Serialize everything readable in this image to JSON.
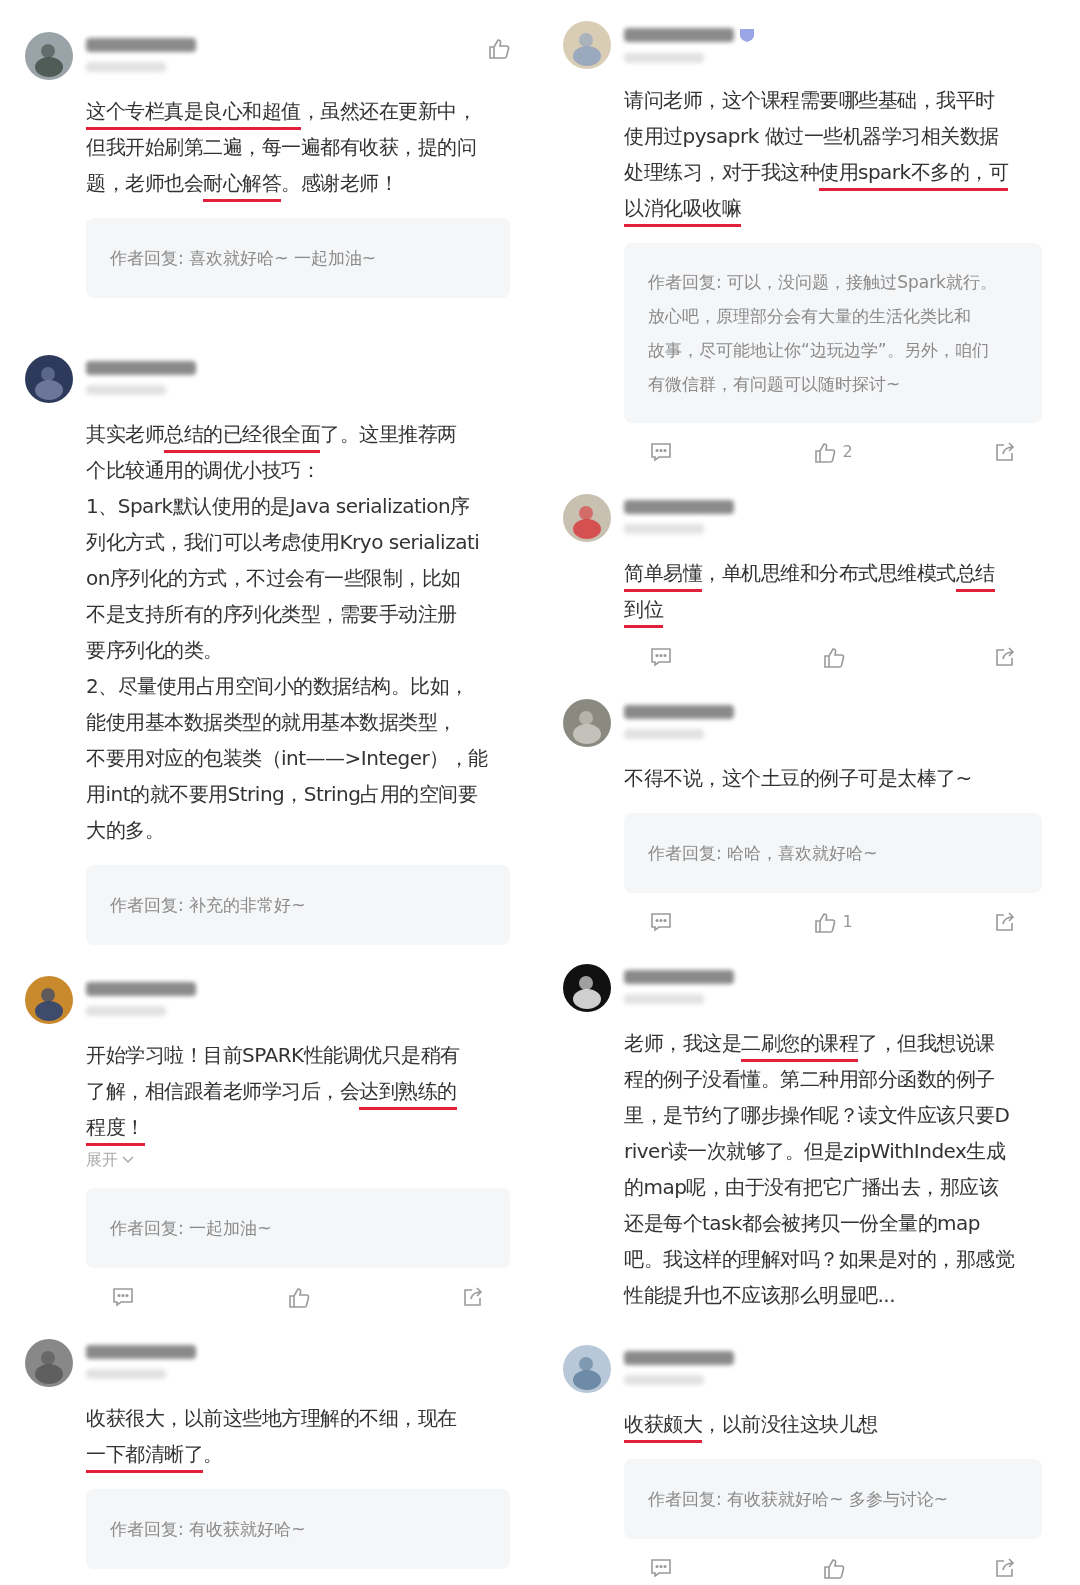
{
  "columns": [
    {
      "comments": [
        {
          "header_like": true,
          "badge": false,
          "lines": [
            [
              {
                "text": "这个专栏真是良心和超值",
                "underlined": true
              },
              {
                "text": "，虽然还在更新中，",
                "underlined": false
              }
            ],
            [
              {
                "text": "但我开始刷第二遍，每一遍都有收获，提的问",
                "underlined": false
              }
            ],
            [
              {
                "text": "题，老师也会",
                "underlined": false
              },
              {
                "text": "耐心解答",
                "underlined": true
              },
              {
                "text": "。感谢老师！",
                "underlined": false
              }
            ]
          ],
          "reply": [
            "作者回复: 喜欢就好哈~ 一起加油~"
          ]
        },
        {
          "header_like": false,
          "badge": false,
          "lines": [
            [
              {
                "text": "其实老师",
                "underlined": false
              },
              {
                "text": "总结的已经很全面",
                "underlined": true
              },
              {
                "text": "了。这里推荐两",
                "underlined": false
              }
            ],
            [
              {
                "text": "个比较通用的调优小技巧：",
                "underlined": false
              }
            ],
            [
              {
                "text": "1、Spark默认使用的是Java serialization序",
                "underlined": false
              }
            ],
            [
              {
                "text": "列化方式，我们可以考虑使用Kryo serializati",
                "underlined": false
              }
            ],
            [
              {
                "text": "on序列化的方式，不过会有一些限制，比如",
                "underlined": false
              }
            ],
            [
              {
                "text": "不是支持所有的序列化类型，需要手动注册",
                "underlined": false
              }
            ],
            [
              {
                "text": "要序列化的类。",
                "underlined": false
              }
            ],
            [
              {
                "text": "2、尽量使用占用空间小的数据结构。比如，",
                "underlined": false
              }
            ],
            [
              {
                "text": "能使用基本数据类型的就用基本数据类型，",
                "underlined": false
              }
            ],
            [
              {
                "text": "不要用对应的包装类（int——>Integer），能",
                "underlined": false
              }
            ],
            [
              {
                "text": "用int的就不要用String，String占用的空间要",
                "underlined": false
              }
            ],
            [
              {
                "text": "大的多。",
                "underlined": false
              }
            ]
          ],
          "reply": [
            "作者回复: 补充的非常好~"
          ]
        },
        {
          "header_like": false,
          "badge": false,
          "lines": [
            [
              {
                "text": "开始学习啦！目前SPARK性能调优只是稍有",
                "underlined": false
              }
            ],
            [
              {
                "text": "了解，相信跟着老师学习后，会",
                "underlined": false
              },
              {
                "text": "达到熟练的",
                "underlined": true
              }
            ],
            [
              {
                "text": "程度！",
                "underlined": true
              }
            ]
          ],
          "expand_label": "展开",
          "reply": [
            "作者回复: 一起加油~"
          ],
          "actions": [
            {
              "kind": "comment"
            },
            {
              "kind": "like"
            },
            {
              "kind": "share"
            }
          ]
        },
        {
          "header_like": false,
          "badge": false,
          "lines": [
            [
              {
                "text": "收获很大，以前这些地方理解的不细，现在",
                "underlined": false
              }
            ],
            [
              {
                "text": "一下都清晰了",
                "underlined": true
              },
              {
                "text": "。",
                "underlined": false
              }
            ]
          ],
          "reply": [
            "作者回复: 有收获就好哈~"
          ]
        }
      ]
    },
    {
      "comments": [
        {
          "header_like": false,
          "badge": true,
          "lines": [
            [
              {
                "text": "请问老师，这个课程需要哪些基础，我平时",
                "underlined": false
              }
            ],
            [
              {
                "text": "使用过pysaprk 做过一些机器学习相关数据",
                "underlined": false
              }
            ],
            [
              {
                "text": "处理练习，对于我这种",
                "underlined": false
              },
              {
                "text": "使用spark不多的，可",
                "underlined": true
              }
            ],
            [
              {
                "text": "以消化吸收嘛",
                "underlined": true
              }
            ]
          ],
          "reply": [
            "作者回复: 可以，没问题，接触过Spark就行。",
            "放心吧，原理部分会有大量的生活化类比和",
            "故事，尽可能地让你“边玩边学”。另外，咱们",
            "有微信群，有问题可以随时探讨~"
          ],
          "actions": [
            {
              "kind": "comment"
            },
            {
              "kind": "like",
              "count": "2"
            },
            {
              "kind": "share"
            }
          ]
        },
        {
          "header_like": false,
          "badge": false,
          "lines": [
            [
              {
                "text": "简单易懂",
                "underlined": true
              },
              {
                "text": "，单机思维和分布式思维模式",
                "underlined": false
              },
              {
                "text": "总结",
                "underlined": true
              }
            ],
            [
              {
                "text": "到位",
                "underlined": true
              }
            ]
          ],
          "actions": [
            {
              "kind": "comment"
            },
            {
              "kind": "like"
            },
            {
              "kind": "share"
            }
          ]
        },
        {
          "header_like": false,
          "badge": false,
          "lines": [
            [
              {
                "text": "不得不说，这个土豆的例子可是太棒了~",
                "underlined": false
              }
            ]
          ],
          "reply": [
            "作者回复: 哈哈，喜欢就好哈~"
          ],
          "actions": [
            {
              "kind": "comment"
            },
            {
              "kind": "like",
              "count": "1"
            },
            {
              "kind": "share"
            }
          ]
        },
        {
          "header_like": false,
          "badge": false,
          "lines": [
            [
              {
                "text": "老师，我这是",
                "underlined": false
              },
              {
                "text": "二刷您的课程",
                "underlined": true
              },
              {
                "text": "了，但我想说课",
                "underlined": false
              }
            ],
            [
              {
                "text": "程的例子没看懂。第二种用部分函数的例子",
                "underlined": false
              }
            ],
            [
              {
                "text": "里，是节约了哪步操作呢？读文件应该只要D",
                "underlined": false
              }
            ],
            [
              {
                "text": "river读一次就够了。但是zipWithIndex生成",
                "underlined": false
              }
            ],
            [
              {
                "text": "的map呢，由于没有把它广播出去，那应该",
                "underlined": false
              }
            ],
            [
              {
                "text": "还是每个task都会被拷贝一份全量的map",
                "underlined": false
              }
            ],
            [
              {
                "text": "吧。我这样的理解对吗？如果是对的，那感觉",
                "underlined": false
              }
            ],
            [
              {
                "text": "性能提升也不应该那么明显吧...",
                "underlined": false
              }
            ]
          ]
        },
        {
          "header_like": false,
          "badge": false,
          "lines": [
            [
              {
                "text": "收获颇大",
                "underlined": true
              },
              {
                "text": "，以前没往这块儿想",
                "underlined": false
              }
            ]
          ],
          "reply": [
            "作者回复: 有收获就好哈~ 多参与讨论~"
          ],
          "actions": [
            {
              "kind": "comment"
            },
            {
              "kind": "like"
            },
            {
              "kind": "share"
            }
          ]
        }
      ]
    }
  ]
}
